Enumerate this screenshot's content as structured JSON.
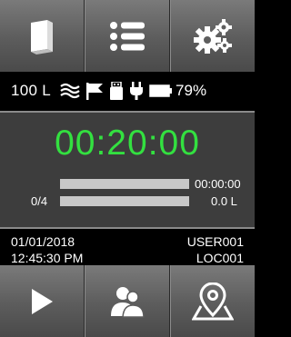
{
  "top_buttons": [
    {
      "icon": "book-icon"
    },
    {
      "icon": "list-icon"
    },
    {
      "icon": "settings-gears-icon"
    }
  ],
  "status_bar": {
    "volume": "100 L",
    "icons": [
      "flow-waves-icon",
      "flag-icon",
      "usb-drive-icon",
      "power-plug-icon",
      "battery-icon"
    ],
    "battery_percent": "79%"
  },
  "main_panel": {
    "timer": "00:20:00",
    "elapsed": "00:00:00",
    "count": "0/4",
    "liters": "0.0 L",
    "timer_color": "#33e040"
  },
  "info": {
    "date": "01/01/2018",
    "time": "12:45:30 PM",
    "user": "USER001",
    "location": "LOC001"
  },
  "bottom_buttons": [
    {
      "icon": "play-icon"
    },
    {
      "icon": "users-icon"
    },
    {
      "icon": "map-location-icon"
    }
  ]
}
